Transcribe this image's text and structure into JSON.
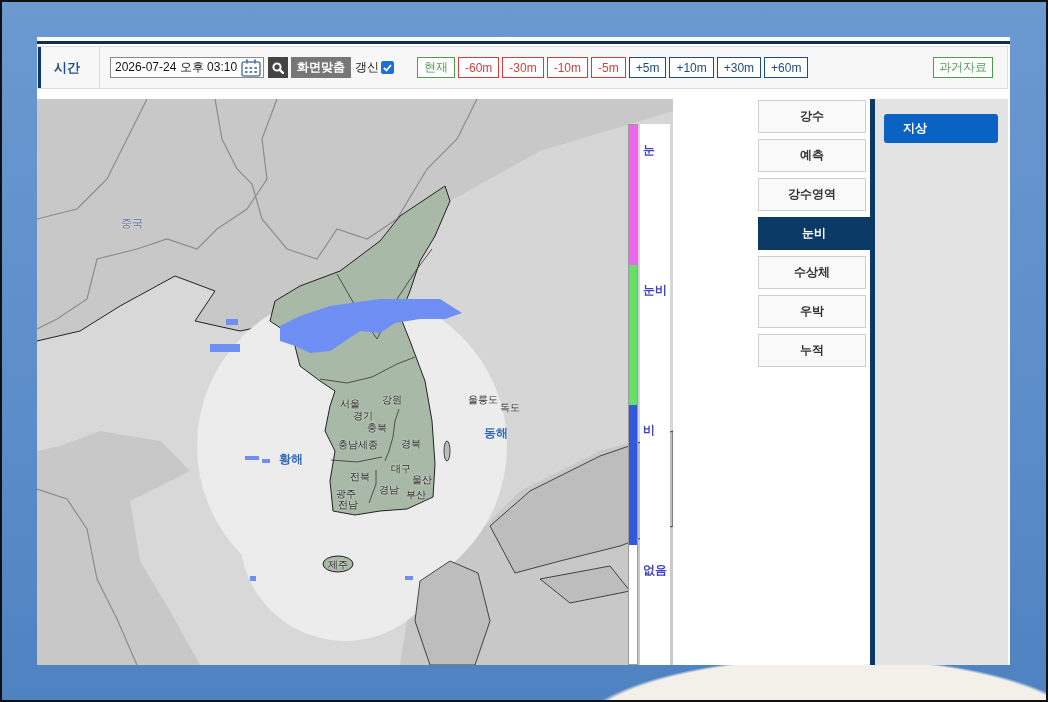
{
  "toolbar": {
    "label": "시간",
    "datetime": "2026-07-24 오후 03:10",
    "fit_button": "화면맞춤",
    "refresh": {
      "label": "갱신",
      "checked": true
    },
    "steps": [
      {
        "label": "현재",
        "kind": "now"
      },
      {
        "label": "-60m",
        "kind": "back"
      },
      {
        "label": "-30m",
        "kind": "back"
      },
      {
        "label": "-10m",
        "kind": "back"
      },
      {
        "label": "-5m",
        "kind": "back"
      },
      {
        "label": "+5m",
        "kind": "forward"
      },
      {
        "label": "+10m",
        "kind": "forward"
      },
      {
        "label": "+30m",
        "kind": "forward"
      },
      {
        "label": "+60m",
        "kind": "forward"
      }
    ],
    "archive_button": "과거자료"
  },
  "map": {
    "labels": [
      {
        "text": "중국",
        "kind": "country"
      },
      {
        "text": "서울",
        "kind": "place"
      },
      {
        "text": "강원",
        "kind": "place"
      },
      {
        "text": "울릉도",
        "kind": "place"
      },
      {
        "text": "경기",
        "kind": "place"
      },
      {
        "text": "독도",
        "kind": "place"
      },
      {
        "text": "충북",
        "kind": "place"
      },
      {
        "text": "충남세종",
        "kind": "place"
      },
      {
        "text": "경북",
        "kind": "place"
      },
      {
        "text": "동해",
        "kind": "sea"
      },
      {
        "text": "황해",
        "kind": "sea"
      },
      {
        "text": "전북",
        "kind": "place"
      },
      {
        "text": "대구",
        "kind": "place"
      },
      {
        "text": "울산",
        "kind": "place"
      },
      {
        "text": "광주",
        "kind": "place"
      },
      {
        "text": "경남",
        "kind": "place"
      },
      {
        "text": "부산",
        "kind": "place"
      },
      {
        "text": "전남",
        "kind": "place"
      },
      {
        "text": "제주",
        "kind": "place"
      }
    ],
    "legend": [
      {
        "label": "눈",
        "color": "#ee66ee"
      },
      {
        "label": "눈비",
        "color": "#66e066"
      },
      {
        "label": "비",
        "color": "#3358dd"
      },
      {
        "label": "없음",
        "color": "#ffffff"
      }
    ]
  },
  "menu": [
    {
      "label": "강수",
      "selected": false
    },
    {
      "label": "예측",
      "selected": false
    },
    {
      "label": "강수영역",
      "selected": false
    },
    {
      "label": "눈비",
      "selected": true
    },
    {
      "label": "수상체",
      "selected": false
    },
    {
      "label": "우박",
      "selected": false
    },
    {
      "label": "누적",
      "selected": false
    }
  ],
  "subpanel": {
    "items": [
      {
        "label": "지상",
        "selected": true
      }
    ]
  }
}
